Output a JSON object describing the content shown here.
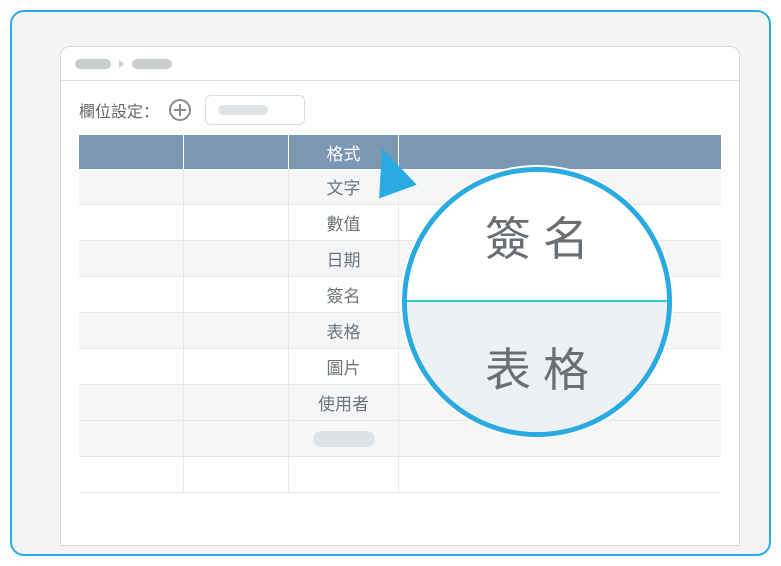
{
  "toolbar": {
    "label": "欄位設定："
  },
  "table": {
    "header": {
      "c1": "",
      "c2": "",
      "c3": "格式",
      "c4": ""
    },
    "rows": [
      {
        "c3": "文字"
      },
      {
        "c3": "數值"
      },
      {
        "c3": "日期"
      },
      {
        "c3": "簽名"
      },
      {
        "c3": "表格"
      },
      {
        "c3": "圖片"
      },
      {
        "c3": "使用者"
      }
    ]
  },
  "magnifier": {
    "top": "簽名",
    "bottom": "表格"
  }
}
